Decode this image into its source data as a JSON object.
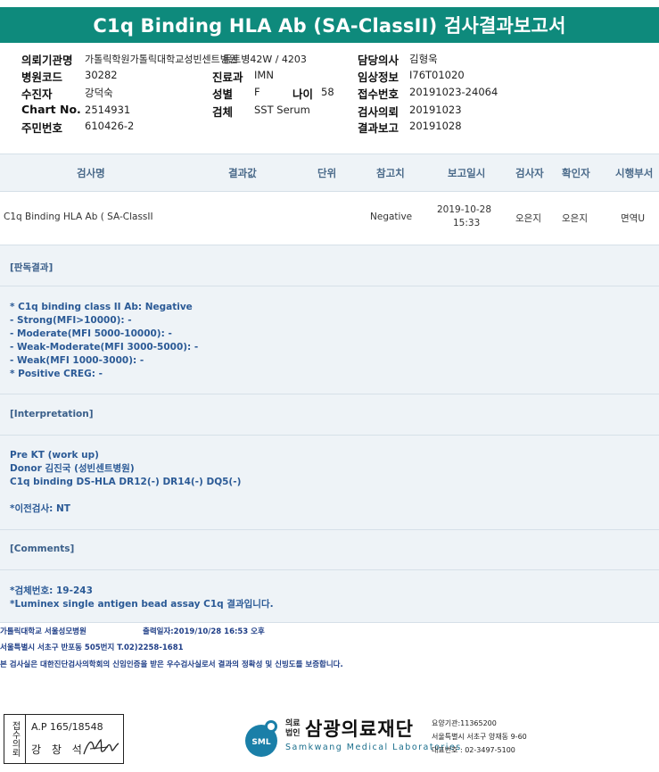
{
  "title": "C1q Binding HLA Ab (SA-ClassII) 검사결과보고서",
  "info": {
    "left": [
      {
        "label": "의뢰기관명",
        "value": "가톨릭학원가톨릭대학교성빈센트병원"
      },
      {
        "label": "병원코드",
        "value": "30282"
      },
      {
        "label": "수진자",
        "value": "강덕숙"
      },
      {
        "label": "Chart No.",
        "value": "2514931"
      },
      {
        "label": "주민번호",
        "value": "610426-2"
      }
    ],
    "ward": "동트병42W / 4203",
    "middle": [
      {
        "label": "진료과",
        "value": "IMN"
      },
      {
        "label": "성별",
        "value": "F"
      },
      {
        "label": "검체",
        "value": "SST Serum"
      }
    ],
    "age_label": "나이",
    "age_value": "58",
    "right": [
      {
        "label": "담당의사",
        "value": "김형욱"
      },
      {
        "label": "임상정보",
        "value": "I76T01020"
      },
      {
        "label": "접수번호",
        "value": "20191023-24064"
      },
      {
        "label": "검사의뢰",
        "value": "20191023"
      },
      {
        "label": "결과보고",
        "value": "20191028"
      }
    ]
  },
  "grid": {
    "headers": [
      "검사명",
      "결과값",
      "단위",
      "참고치",
      "보고일시",
      "검사자",
      "확인자",
      "시행부서"
    ],
    "row": {
      "test_name": "C1q Binding HLA Ab ( SA-ClassII",
      "result": "",
      "unit": "",
      "reference": "Negative",
      "report_date": "2019-10-28",
      "report_time": "15:33",
      "tester": "오은지",
      "confirmer": "오은지",
      "department": "면역U"
    }
  },
  "sections": {
    "judgement_title": "[판독결과]",
    "judgement_body": "* C1q binding class II Ab: Negative\n- Strong(MFI>10000): -\n- Moderate(MFI 5000-10000): -\n- Weak-Moderate(MFI 3000-5000): -\n- Weak(MFI 1000-3000): -\n* Positive CREG: -",
    "interpretation_title": "[Interpretation]",
    "interpretation_body": "Pre KT (work up)\nDonor 김진국 (성빈센트병원)\nC1q binding DS-HLA DR12(-) DR14(-) DQ5(-)\n\n*이전검사: NT",
    "comments_title": "[Comments]",
    "comments_body": "*검체번호: 19-243\n*Luminex single antigen bead assay C1q 결과입니다."
  },
  "print_info": {
    "line1_org": "가톨릭대학교 서울성모병원",
    "line1_print": "출력일자:2019/10/28 16:53 오후",
    "line2": "서울특별시 서초구 반포동 505번지 T.02)2258-1681",
    "line3": "본 검사실은 대한진단검사의학회의 신임인증을 받은 우수검사실로서 결과의 정확성 및 신빙도를 보증합니다."
  },
  "footer": {
    "stamp_label": "접수의뢰",
    "ap": "A.P 165/18548",
    "name": "강 창 석",
    "logo_text": "SML",
    "org_small": "의료\n법인",
    "org_name": "삼광의료재단",
    "org_eng": "Samkwang Medical Laboratories",
    "org_code": "요양기관:11365200",
    "org_address": "서울특별시 서초구 양재동 9-60",
    "org_phone": "대표번호 : 02-3497-5100"
  },
  "colors": {
    "title_bar": "#0e8a7c",
    "section_bg": "#eef3f7",
    "body_text": "#2b5a96",
    "lab_info": "#1f3e87"
  }
}
